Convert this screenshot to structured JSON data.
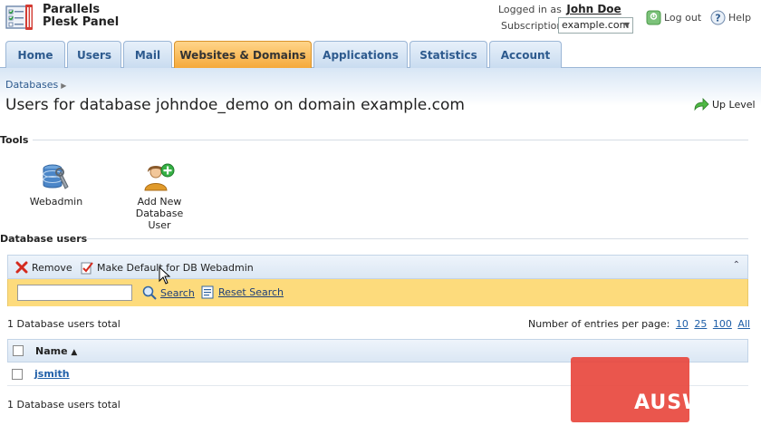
{
  "header": {
    "brand_line1": "Parallels",
    "brand_line2": "Plesk Panel",
    "logged_in_label": "Logged in as",
    "user_name": "John Doe",
    "subscription_label": "Subscription",
    "subscription_value": "example.com",
    "logout_label": "Log out",
    "help_label": "Help"
  },
  "tabs": [
    {
      "label": "Home"
    },
    {
      "label": "Users"
    },
    {
      "label": "Mail"
    },
    {
      "label": "Websites & Domains",
      "active": true
    },
    {
      "label": "Applications"
    },
    {
      "label": "Statistics"
    },
    {
      "label": "Account"
    }
  ],
  "breadcrumb": {
    "item": "Databases"
  },
  "page": {
    "title": "Users for database johndoe_demo on domain example.com",
    "up_level": "Up Level"
  },
  "tools": {
    "section_title": "Tools",
    "items": [
      {
        "label": "Webadmin",
        "icon": "database-settings-icon"
      },
      {
        "label_line1": "Add New Database",
        "label_line2": "User",
        "icon": "add-user-icon"
      }
    ]
  },
  "db_users": {
    "section_title": "Database users",
    "toolbar": {
      "remove": "Remove",
      "make_default": "Make Default for DB Webadmin"
    },
    "search": {
      "search_link": "Search",
      "reset_link": "Reset Search",
      "value": ""
    },
    "total_top": "1 Database users total",
    "total_bottom": "1 Database users total",
    "per_page_label": "Number of entries per page:",
    "per_page_options": [
      "10",
      "25",
      "100",
      "All"
    ],
    "column_name": "Name",
    "sort_indicator": "▲",
    "rows": [
      {
        "name": "jsmith"
      }
    ]
  },
  "watermark": {
    "text": "AUSWEB"
  },
  "colors": {
    "active_tab": "#f5a93a",
    "tab_text": "#2d5a8e",
    "search_bar": "#fddb7c",
    "link": "#1f5fa8",
    "watermark": "#e8483e"
  }
}
